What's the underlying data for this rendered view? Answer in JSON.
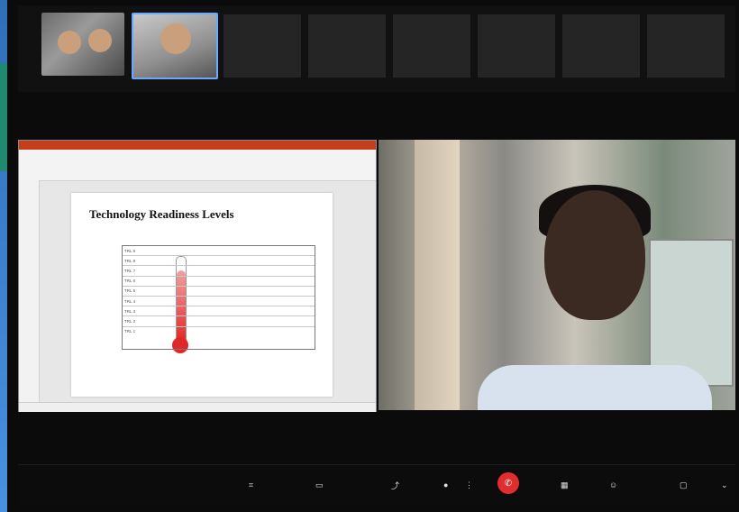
{
  "top_strip": {
    "participant_tiles": [
      "",
      "",
      "",
      "",
      "",
      ""
    ]
  },
  "share": {
    "slide": {
      "title": "Technology Readiness Levels",
      "rows": [
        {
          "level": "TRL 1",
          "text": ""
        },
        {
          "level": "TRL 2",
          "text": ""
        },
        {
          "level": "TRL 3",
          "text": ""
        },
        {
          "level": "TRL 4",
          "text": ""
        },
        {
          "level": "TRL 5",
          "text": ""
        },
        {
          "level": "TRL 6",
          "text": ""
        },
        {
          "level": "TRL 7",
          "text": ""
        },
        {
          "level": "TRL 8",
          "text": ""
        },
        {
          "level": "TRL 9",
          "text": ""
        }
      ],
      "side_labels": [
        "",
        "",
        "",
        "",
        "",
        ""
      ]
    }
  },
  "controls": {
    "camera_label": "",
    "stop_video_label": "",
    "share_label": "",
    "apps_label": "",
    "participants_label": "",
    "chat_label": ""
  },
  "icons": {
    "camera": "camera-icon",
    "video": "video-icon",
    "share": "share-icon",
    "mic": "mic-icon",
    "leave": "leave-icon",
    "apps": "apps-icon",
    "participants": "participants-icon",
    "chat": "chat-icon"
  },
  "colors": {
    "leave": "#e02d2d",
    "active_thumb_border": "#6aa7ff",
    "ppt_accent": "#c43e1c"
  }
}
